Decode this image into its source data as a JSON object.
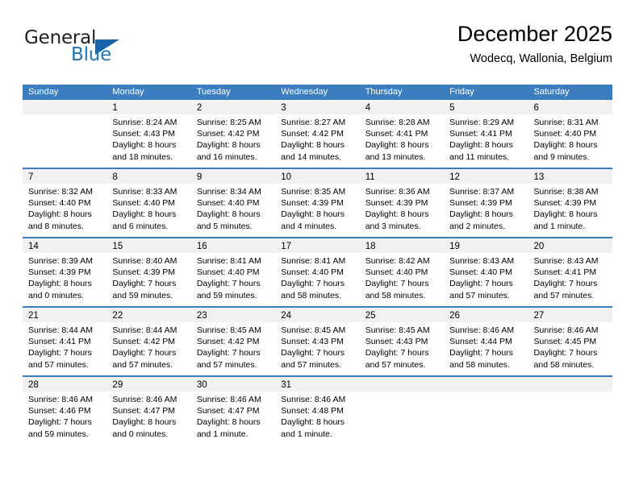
{
  "brand": {
    "name_part1": "General",
    "name_part2": "Blue",
    "accent_color": "#1d76bc",
    "triangle_color": "#1665a8"
  },
  "header": {
    "title": "December 2025",
    "subtitle": "Wodecq, Wallonia, Belgium"
  },
  "calendar": {
    "header_bg": "#3c7dbf",
    "day_band_bg": "#f1f1f1",
    "weekdays": [
      "Sunday",
      "Monday",
      "Tuesday",
      "Wednesday",
      "Thursday",
      "Friday",
      "Saturday"
    ],
    "weeks": [
      [
        {
          "day": "",
          "sunrise": "",
          "sunset": "",
          "daylight1": "",
          "daylight2": "",
          "empty": true
        },
        {
          "day": "1",
          "sunrise": "Sunrise: 8:24 AM",
          "sunset": "Sunset: 4:43 PM",
          "daylight1": "Daylight: 8 hours",
          "daylight2": "and 18 minutes.",
          "empty": false
        },
        {
          "day": "2",
          "sunrise": "Sunrise: 8:25 AM",
          "sunset": "Sunset: 4:42 PM",
          "daylight1": "Daylight: 8 hours",
          "daylight2": "and 16 minutes.",
          "empty": false
        },
        {
          "day": "3",
          "sunrise": "Sunrise: 8:27 AM",
          "sunset": "Sunset: 4:42 PM",
          "daylight1": "Daylight: 8 hours",
          "daylight2": "and 14 minutes.",
          "empty": false
        },
        {
          "day": "4",
          "sunrise": "Sunrise: 8:28 AM",
          "sunset": "Sunset: 4:41 PM",
          "daylight1": "Daylight: 8 hours",
          "daylight2": "and 13 minutes.",
          "empty": false
        },
        {
          "day": "5",
          "sunrise": "Sunrise: 8:29 AM",
          "sunset": "Sunset: 4:41 PM",
          "daylight1": "Daylight: 8 hours",
          "daylight2": "and 11 minutes.",
          "empty": false
        },
        {
          "day": "6",
          "sunrise": "Sunrise: 8:31 AM",
          "sunset": "Sunset: 4:40 PM",
          "daylight1": "Daylight: 8 hours",
          "daylight2": "and 9 minutes.",
          "empty": false
        }
      ],
      [
        {
          "day": "7",
          "sunrise": "Sunrise: 8:32 AM",
          "sunset": "Sunset: 4:40 PM",
          "daylight1": "Daylight: 8 hours",
          "daylight2": "and 8 minutes.",
          "empty": false
        },
        {
          "day": "8",
          "sunrise": "Sunrise: 8:33 AM",
          "sunset": "Sunset: 4:40 PM",
          "daylight1": "Daylight: 8 hours",
          "daylight2": "and 6 minutes.",
          "empty": false
        },
        {
          "day": "9",
          "sunrise": "Sunrise: 8:34 AM",
          "sunset": "Sunset: 4:40 PM",
          "daylight1": "Daylight: 8 hours",
          "daylight2": "and 5 minutes.",
          "empty": false
        },
        {
          "day": "10",
          "sunrise": "Sunrise: 8:35 AM",
          "sunset": "Sunset: 4:39 PM",
          "daylight1": "Daylight: 8 hours",
          "daylight2": "and 4 minutes.",
          "empty": false
        },
        {
          "day": "11",
          "sunrise": "Sunrise: 8:36 AM",
          "sunset": "Sunset: 4:39 PM",
          "daylight1": "Daylight: 8 hours",
          "daylight2": "and 3 minutes.",
          "empty": false
        },
        {
          "day": "12",
          "sunrise": "Sunrise: 8:37 AM",
          "sunset": "Sunset: 4:39 PM",
          "daylight1": "Daylight: 8 hours",
          "daylight2": "and 2 minutes.",
          "empty": false
        },
        {
          "day": "13",
          "sunrise": "Sunrise: 8:38 AM",
          "sunset": "Sunset: 4:39 PM",
          "daylight1": "Daylight: 8 hours",
          "daylight2": "and 1 minute.",
          "empty": false
        }
      ],
      [
        {
          "day": "14",
          "sunrise": "Sunrise: 8:39 AM",
          "sunset": "Sunset: 4:39 PM",
          "daylight1": "Daylight: 8 hours",
          "daylight2": "and 0 minutes.",
          "empty": false
        },
        {
          "day": "15",
          "sunrise": "Sunrise: 8:40 AM",
          "sunset": "Sunset: 4:39 PM",
          "daylight1": "Daylight: 7 hours",
          "daylight2": "and 59 minutes.",
          "empty": false
        },
        {
          "day": "16",
          "sunrise": "Sunrise: 8:41 AM",
          "sunset": "Sunset: 4:40 PM",
          "daylight1": "Daylight: 7 hours",
          "daylight2": "and 59 minutes.",
          "empty": false
        },
        {
          "day": "17",
          "sunrise": "Sunrise: 8:41 AM",
          "sunset": "Sunset: 4:40 PM",
          "daylight1": "Daylight: 7 hours",
          "daylight2": "and 58 minutes.",
          "empty": false
        },
        {
          "day": "18",
          "sunrise": "Sunrise: 8:42 AM",
          "sunset": "Sunset: 4:40 PM",
          "daylight1": "Daylight: 7 hours",
          "daylight2": "and 58 minutes.",
          "empty": false
        },
        {
          "day": "19",
          "sunrise": "Sunrise: 8:43 AM",
          "sunset": "Sunset: 4:40 PM",
          "daylight1": "Daylight: 7 hours",
          "daylight2": "and 57 minutes.",
          "empty": false
        },
        {
          "day": "20",
          "sunrise": "Sunrise: 8:43 AM",
          "sunset": "Sunset: 4:41 PM",
          "daylight1": "Daylight: 7 hours",
          "daylight2": "and 57 minutes.",
          "empty": false
        }
      ],
      [
        {
          "day": "21",
          "sunrise": "Sunrise: 8:44 AM",
          "sunset": "Sunset: 4:41 PM",
          "daylight1": "Daylight: 7 hours",
          "daylight2": "and 57 minutes.",
          "empty": false
        },
        {
          "day": "22",
          "sunrise": "Sunrise: 8:44 AM",
          "sunset": "Sunset: 4:42 PM",
          "daylight1": "Daylight: 7 hours",
          "daylight2": "and 57 minutes.",
          "empty": false
        },
        {
          "day": "23",
          "sunrise": "Sunrise: 8:45 AM",
          "sunset": "Sunset: 4:42 PM",
          "daylight1": "Daylight: 7 hours",
          "daylight2": "and 57 minutes.",
          "empty": false
        },
        {
          "day": "24",
          "sunrise": "Sunrise: 8:45 AM",
          "sunset": "Sunset: 4:43 PM",
          "daylight1": "Daylight: 7 hours",
          "daylight2": "and 57 minutes.",
          "empty": false
        },
        {
          "day": "25",
          "sunrise": "Sunrise: 8:45 AM",
          "sunset": "Sunset: 4:43 PM",
          "daylight1": "Daylight: 7 hours",
          "daylight2": "and 57 minutes.",
          "empty": false
        },
        {
          "day": "26",
          "sunrise": "Sunrise: 8:46 AM",
          "sunset": "Sunset: 4:44 PM",
          "daylight1": "Daylight: 7 hours",
          "daylight2": "and 58 minutes.",
          "empty": false
        },
        {
          "day": "27",
          "sunrise": "Sunrise: 8:46 AM",
          "sunset": "Sunset: 4:45 PM",
          "daylight1": "Daylight: 7 hours",
          "daylight2": "and 58 minutes.",
          "empty": false
        }
      ],
      [
        {
          "day": "28",
          "sunrise": "Sunrise: 8:46 AM",
          "sunset": "Sunset: 4:46 PM",
          "daylight1": "Daylight: 7 hours",
          "daylight2": "and 59 minutes.",
          "empty": false
        },
        {
          "day": "29",
          "sunrise": "Sunrise: 8:46 AM",
          "sunset": "Sunset: 4:47 PM",
          "daylight1": "Daylight: 8 hours",
          "daylight2": "and 0 minutes.",
          "empty": false
        },
        {
          "day": "30",
          "sunrise": "Sunrise: 8:46 AM",
          "sunset": "Sunset: 4:47 PM",
          "daylight1": "Daylight: 8 hours",
          "daylight2": "and 1 minute.",
          "empty": false
        },
        {
          "day": "31",
          "sunrise": "Sunrise: 8:46 AM",
          "sunset": "Sunset: 4:48 PM",
          "daylight1": "Daylight: 8 hours",
          "daylight2": "and 1 minute.",
          "empty": false
        },
        {
          "day": "",
          "sunrise": "",
          "sunset": "",
          "daylight1": "",
          "daylight2": "",
          "empty": true
        },
        {
          "day": "",
          "sunrise": "",
          "sunset": "",
          "daylight1": "",
          "daylight2": "",
          "empty": true
        },
        {
          "day": "",
          "sunrise": "",
          "sunset": "",
          "daylight1": "",
          "daylight2": "",
          "empty": true
        }
      ]
    ]
  }
}
